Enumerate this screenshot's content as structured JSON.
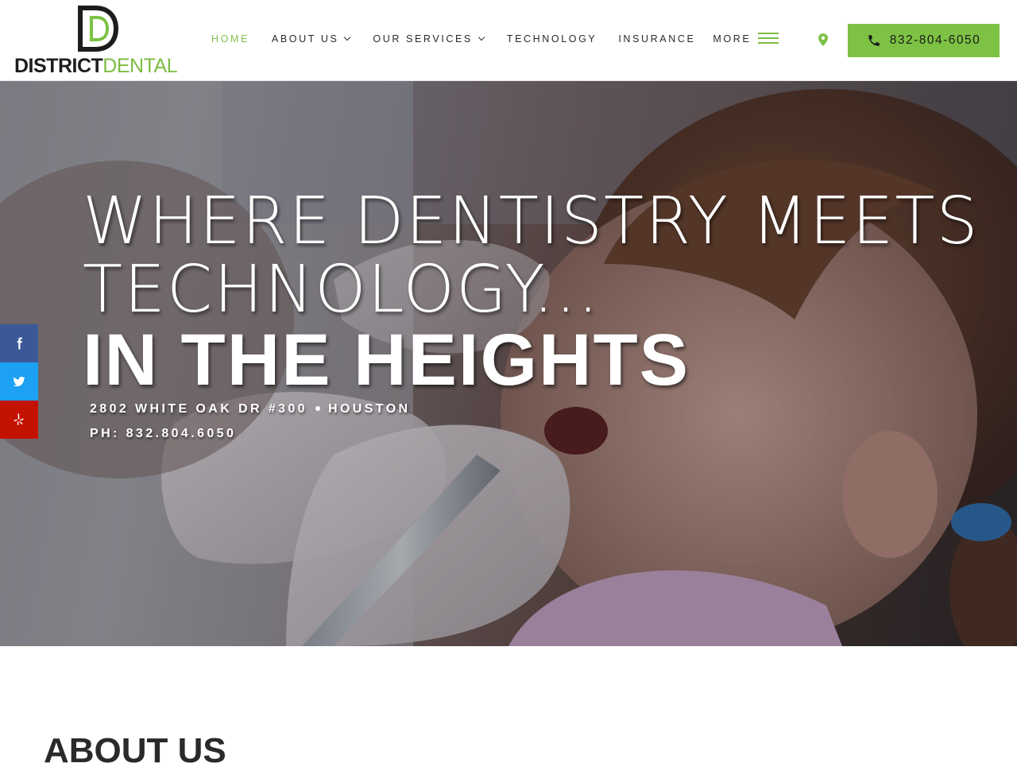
{
  "brand": {
    "logo_letter": "D",
    "name_part1": "DISTRICT",
    "name_part2": "DENTAL",
    "accent_color": "#7dc244",
    "dark_color": "#1d1d1d"
  },
  "nav": {
    "items": [
      {
        "label": "HOME",
        "active": true,
        "has_dropdown": false
      },
      {
        "label": "ABOUT US",
        "active": false,
        "has_dropdown": true
      },
      {
        "label": "OUR SERVICES",
        "active": false,
        "has_dropdown": true
      },
      {
        "label": "TECHNOLOGY",
        "active": false,
        "has_dropdown": false
      },
      {
        "label": "INSURANCE",
        "active": false,
        "has_dropdown": false
      },
      {
        "label": "MORE",
        "active": false,
        "has_dropdown": false
      }
    ],
    "more_icon": "hamburger-icon",
    "location_icon": "map-pin-icon"
  },
  "phone_button": {
    "icon": "phone-icon",
    "label": "832-804-6050"
  },
  "hero": {
    "headline_line1": "WHERE DENTISTRY MEETS",
    "headline_line2": "TECHNOLOGY...",
    "headline_line3": "IN THE HEIGHTS",
    "address": "2802 WHITE OAK DR #300",
    "city": "HOUSTON",
    "phone": "PH: 832.804.6050"
  },
  "social": [
    {
      "name": "facebook",
      "icon": "facebook-icon",
      "color": "#3b5998"
    },
    {
      "name": "twitter",
      "icon": "twitter-icon",
      "color": "#1da1f2"
    },
    {
      "name": "yelp",
      "icon": "yelp-icon",
      "color": "#c41200"
    }
  ],
  "about": {
    "title": "ABOUT US"
  }
}
